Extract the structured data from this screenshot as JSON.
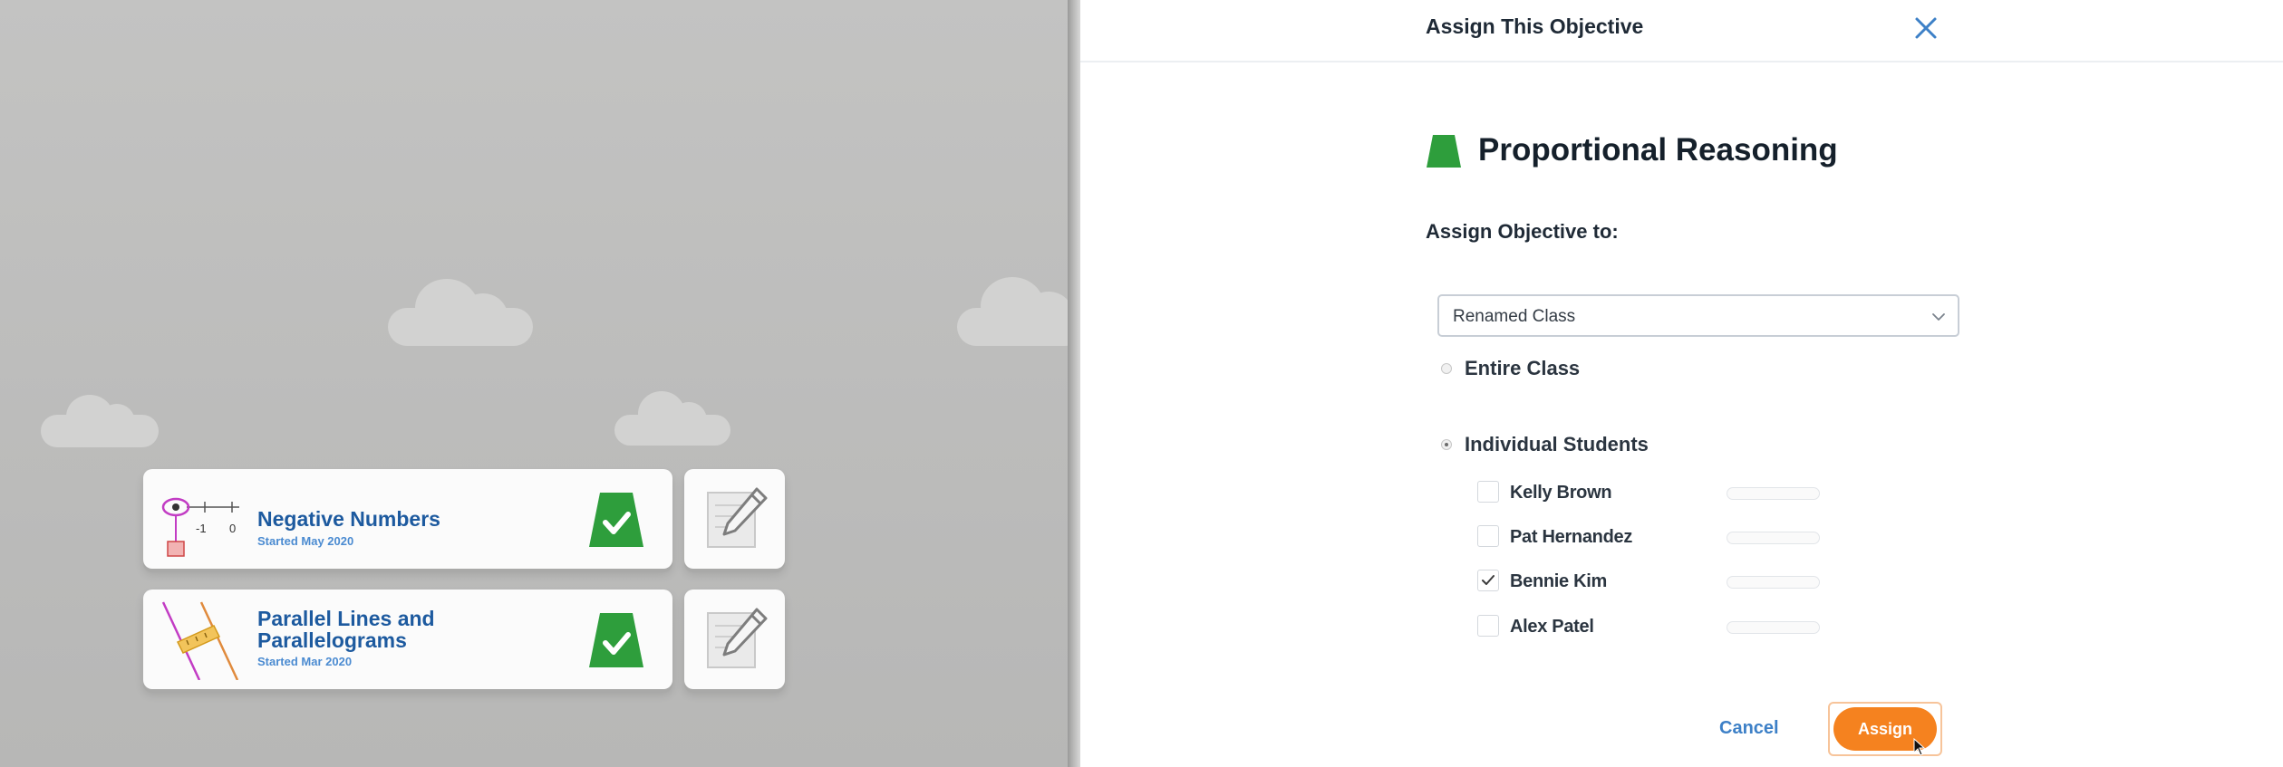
{
  "colors": {
    "background_gray": "#bebebd",
    "card_title_blue": "#1d5a9f",
    "card_subtitle_blue": "#4b8bd1",
    "badge_green": "#2e9e3c",
    "assign_orange": "#f5821f",
    "cancel_blue": "#3d80c7",
    "close_blue": "#3d80c7"
  },
  "objectives": [
    {
      "title": "Negative Numbers",
      "subtitle": "Started May 2020",
      "icon": "number-line-icon",
      "thumb_labels": {
        "neg": "-1",
        "zero": "0"
      },
      "badge_icon": "green-check-badge-icon",
      "edit_icon": "pencil-notepad-icon"
    },
    {
      "title": "Parallel Lines and Parallelograms",
      "subtitle": "Started Mar 2020",
      "icon": "parallel-lines-icon",
      "badge_icon": "green-check-badge-icon",
      "edit_icon": "pencil-notepad-icon"
    }
  ],
  "dialog": {
    "title": "Assign This Objective",
    "close_icon": "close-icon",
    "objective_icon": "green-trapezoid-icon",
    "objective_name": "Proportional Reasoning",
    "assign_to_label": "Assign Objective to:",
    "class_select": {
      "value": "Renamed Class",
      "icon": "chevron-down-icon"
    },
    "options": [
      {
        "label": "Entire Class",
        "selected": false
      },
      {
        "label": "Individual Students",
        "selected": true
      }
    ],
    "students": [
      {
        "name": "Kelly Brown",
        "checked": false
      },
      {
        "name": "Pat Hernandez",
        "checked": false
      },
      {
        "name": "Bennie Kim",
        "checked": true
      },
      {
        "name": "Alex Patel",
        "checked": false
      }
    ],
    "cancel_label": "Cancel",
    "assign_label": "Assign"
  }
}
